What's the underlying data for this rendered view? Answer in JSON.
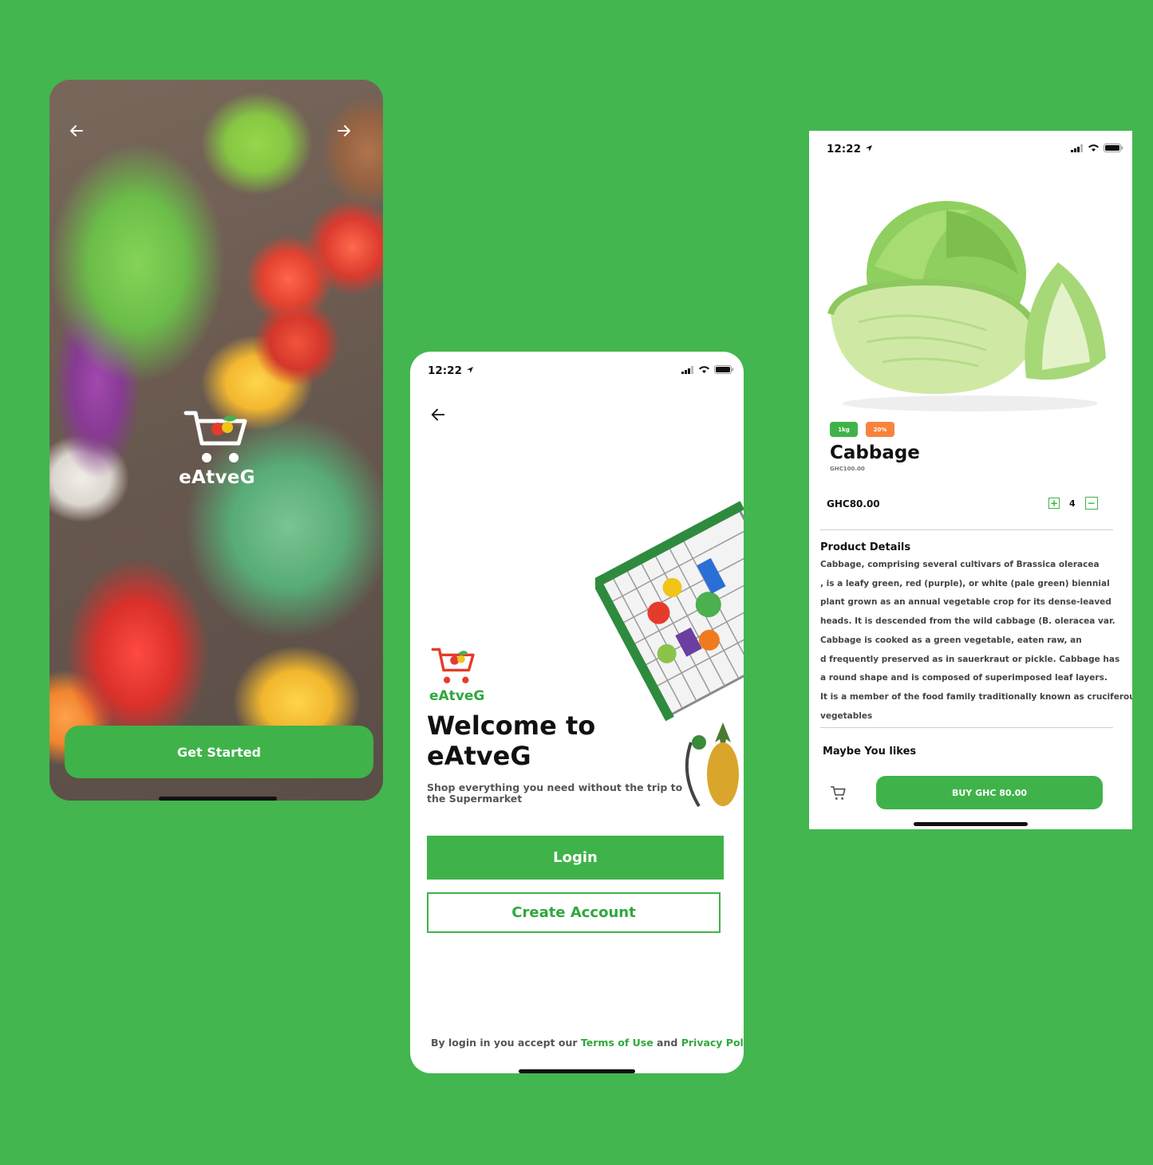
{
  "colors": {
    "background": "#43b64f",
    "brand_green": "#3fb34a",
    "tag_orange": "#f7833c",
    "text_dark": "#111111"
  },
  "splash": {
    "brand_name": "eAtveG",
    "get_started_label": "Get Started",
    "icons": [
      "arrow-left-icon",
      "arrow-right-icon",
      "cart-logo-icon"
    ]
  },
  "welcome": {
    "status_time": "12:22",
    "brand_name": "eAtveG",
    "title_line1": "Welcome to",
    "title_line2": "eAtveG",
    "subtitle": "Shop everything you need without  the trip to the Supermarket",
    "login_label": "Login",
    "create_account_label": "Create Account",
    "terms_prefix": "By login  in you accept our ",
    "terms_of_use": "Terms of Use",
    "terms_and": " and ",
    "privacy_policy": "Privacy Policy"
  },
  "product": {
    "status_time": "12:22",
    "weight_tag": "1kg",
    "discount_tag": "20%",
    "name": "Cabbage",
    "old_price": "GHC100.00",
    "price": "GHC80.00",
    "quantity": "4",
    "plus_symbol": "+",
    "minus_symbol": "−",
    "details_title": "Product Details",
    "details_lines": [
      "Cabbage, comprising several cultivars of Brassica oleracea",
      ", is a leafy green, red (purple), or white (pale green) biennial",
      "plant grown as an annual vegetable crop for its dense-leaved",
      " heads. It is descended from the wild cabbage (B. oleracea var.",
      "Cabbage is cooked as a green vegetable, eaten raw, an",
      "d frequently preserved as in sauerkraut or pickle. Cabbage has",
      " a round shape and is composed of superimposed leaf layers.",
      "It is a member of the food family traditionally known as cruciferous",
      " vegetables"
    ],
    "maybe_title": "Maybe You likes",
    "buy_label": "BUY GHC 80.00"
  }
}
